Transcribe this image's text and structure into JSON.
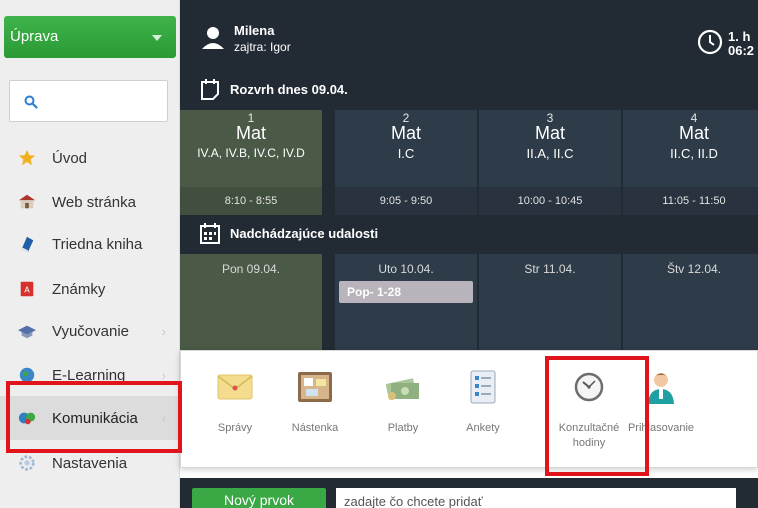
{
  "sidebar": {
    "dropdown_label": "Úprava",
    "items": [
      {
        "label": "Úvod"
      },
      {
        "label": "Web stránka"
      },
      {
        "label": "Triedna kniha"
      },
      {
        "label": "Známky"
      },
      {
        "label": "Vyučovanie"
      },
      {
        "label": "E-Learning"
      },
      {
        "label": "Komunikácia"
      },
      {
        "label": "Nastavenia"
      }
    ]
  },
  "header": {
    "user_name": "Milena",
    "user_sub": "zajtra: Igor",
    "clock_line1": "1. h",
    "clock_line2": "06:2"
  },
  "schedule": {
    "title": "Rozvrh dnes 09.04.",
    "lessons": [
      {
        "num": "1",
        "subject": "Mat",
        "classes": "IV.A, IV.B, IV.C, IV.D",
        "time": "8:10 - 8:55"
      },
      {
        "num": "2",
        "subject": "Mat",
        "classes": "I.C",
        "time": "9:05 - 9:50"
      },
      {
        "num": "3",
        "subject": "Mat",
        "classes": "II.A, II.C",
        "time": "10:00 - 10:45"
      },
      {
        "num": "4",
        "subject": "Mat",
        "classes": "II.C, II.D",
        "time": "11:05 - 11:50"
      }
    ]
  },
  "events": {
    "title": "Nadchádzajúce udalosti",
    "days": [
      {
        "label": "Pon 09.04."
      },
      {
        "label": "Uto 10.04."
      },
      {
        "label": "Str 11.04."
      },
      {
        "label": "Štv 12.04."
      }
    ],
    "chip": "Pop- 1-28"
  },
  "popup": {
    "items": [
      {
        "label": "Správy"
      },
      {
        "label": "Nástenka"
      },
      {
        "label": "Platby"
      },
      {
        "label": "Ankety"
      },
      {
        "label": "Konzultačné hodiny"
      },
      {
        "label": "Prihlasovanie"
      }
    ]
  },
  "bottom": {
    "new_button": "Nový prvok",
    "input_value": "zadajte čo chcete pridať"
  },
  "colors": {
    "accent_green": "#3aa845",
    "dark_panel": "#222a33",
    "highlight_red": "#e0141b"
  }
}
